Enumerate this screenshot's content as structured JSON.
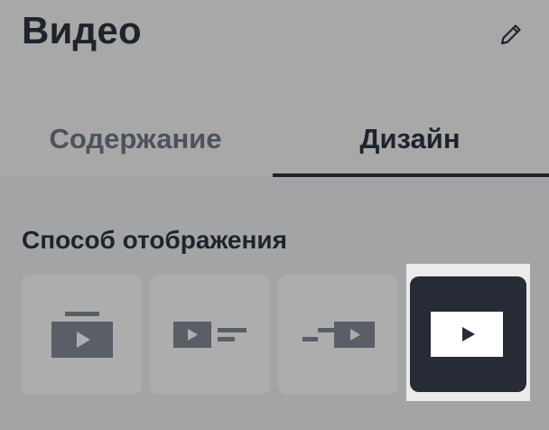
{
  "header": {
    "title": "Видео",
    "edit_icon": "pencil-icon"
  },
  "tabs": [
    {
      "label": "Содержание",
      "active": false
    },
    {
      "label": "Дизайн",
      "active": true
    }
  ],
  "display_mode": {
    "label": "Способ отображения",
    "options": [
      {
        "icon": "title-above-video-icon",
        "selected": false
      },
      {
        "icon": "video-left-text-right-icon",
        "selected": false
      },
      {
        "icon": "text-left-video-right-icon",
        "selected": false
      },
      {
        "icon": "video-only-icon",
        "selected": true
      }
    ]
  },
  "colors": {
    "overlay_bg": "#a3a4a6",
    "text_dark": "#1f232b",
    "selected_bg": "#272b35",
    "icon_gray": "#5a5e66"
  }
}
